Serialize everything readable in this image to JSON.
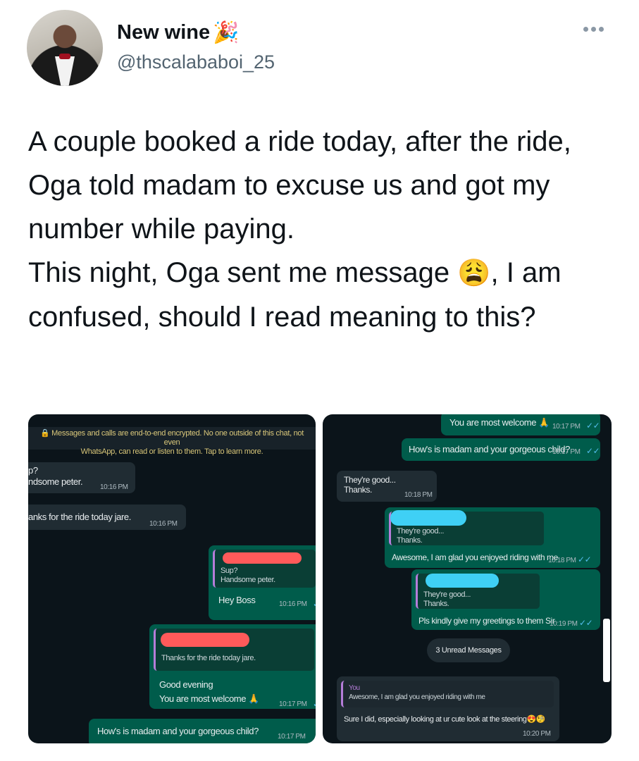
{
  "profile": {
    "name": "New wine",
    "name_emoji": "🎉",
    "handle": "@thscalababoi_25"
  },
  "tweet": {
    "text_part1": "A couple booked a ride today, after the ride, Oga told madam to excuse us and got my number while paying.\nThis night, Oga sent me message ",
    "emoji": "😩",
    "text_part2": ", I am confused, should I read meaning to this?"
  },
  "left_chat": {
    "encryption_line1": "🔒 Messages and calls are end-to-end encrypted. No one outside of this chat, not even",
    "encryption_line2": "WhatsApp, can read or listen to them. Tap to learn more.",
    "in_msg1_line1": "p?",
    "in_msg1_line2": "ndsome peter.",
    "in_msg1_time": "10:16 PM",
    "in_msg2": "anks for the ride today jare.",
    "in_msg2_time": "10:16 PM",
    "out_quote1_line1": "Sup?",
    "out_quote1_line2": "Handsome peter.",
    "out_msg1": "Hey Boss",
    "out_msg1_time": "10:16 PM",
    "out_quote2": "Thanks for the ride today jare.",
    "out_msg2_line1": "Good evening",
    "out_msg2_line2": "You are most welcome 🙏",
    "out_msg2_time": "10:17 PM",
    "out_msg3": "How's is madam and your gorgeous child?",
    "out_msg3_time": "10:17 PM"
  },
  "right_chat": {
    "out_msg1": "You are most welcome 🙏",
    "out_msg1_time": "10:17 PM",
    "out_msg2": "How's is madam and your gorgeous child?",
    "out_msg2_time": "10:17 PM",
    "in_msg1_line1": "They're good...",
    "in_msg1_line2": "Thanks.",
    "in_msg1_time": "10:18 PM",
    "out_quote1_line1": "They're good...",
    "out_quote1_line2": "Thanks.",
    "out_msg3": "Awesome, I am glad you enjoyed riding with me",
    "out_msg3_time": "10:18 PM",
    "out_quote2_line1": "They're good...",
    "out_quote2_line2": "Thanks.",
    "out_msg4": "Pls kindly give my greetings to them Sir",
    "out_msg4_time": "10:19 PM",
    "unread_label": "3 Unread Messages",
    "in_quote_sender": "You",
    "in_quote_text": "Awesome, I am glad you enjoyed riding with me",
    "in_msg2": "Sure I did, especially looking at ur cute look at the steering😍🧐",
    "in_msg2_time": "10:20 PM"
  },
  "colors": {
    "chat_bg": "#0b141a",
    "incoming": "#202c33",
    "outgoing": "#005c4b",
    "tick": "#53bdeb",
    "redaction_red": "#ff5a5a",
    "redaction_blue": "#3fd0f5"
  }
}
